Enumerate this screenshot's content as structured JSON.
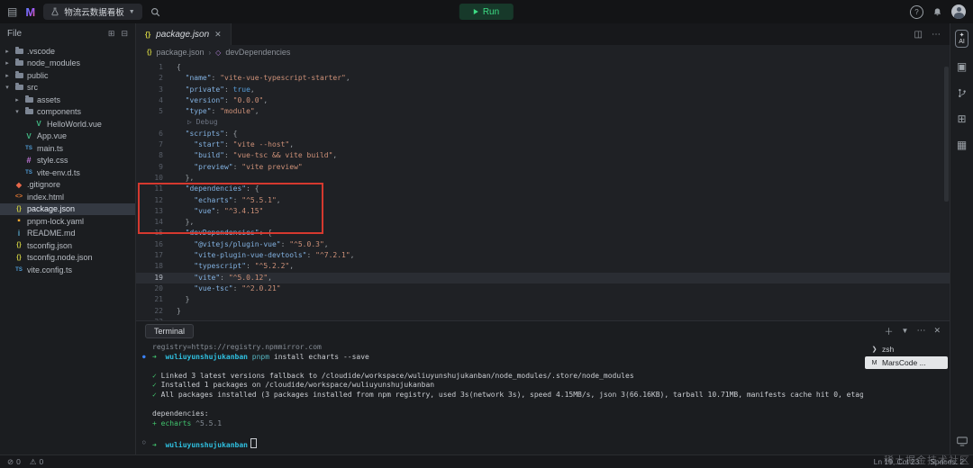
{
  "topbar": {
    "title": "物流云数据看板",
    "run_label": "Run"
  },
  "explorer": {
    "header": "File",
    "items": [
      {
        "label": ".vscode",
        "icon": "folder",
        "folder": true,
        "expanded": false,
        "level": 0
      },
      {
        "label": "node_modules",
        "icon": "folder",
        "folder": true,
        "expanded": false,
        "level": 0
      },
      {
        "label": "public",
        "icon": "folder",
        "folder": true,
        "expanded": false,
        "level": 0
      },
      {
        "label": "src",
        "icon": "folder",
        "folder": true,
        "expanded": true,
        "level": 0
      },
      {
        "label": "assets",
        "icon": "folder",
        "folder": true,
        "expanded": false,
        "level": 1
      },
      {
        "label": "components",
        "icon": "folder",
        "folder": true,
        "expanded": true,
        "level": 1
      },
      {
        "label": "HelloWorld.vue",
        "icon": "vue",
        "level": 2
      },
      {
        "label": "App.vue",
        "icon": "vue",
        "level": 1
      },
      {
        "label": "main.ts",
        "icon": "ts",
        "level": 1
      },
      {
        "label": "style.css",
        "icon": "css",
        "level": 1
      },
      {
        "label": "vite-env.d.ts",
        "icon": "ts",
        "level": 1
      },
      {
        "label": ".gitignore",
        "icon": "git",
        "level": 0
      },
      {
        "label": "index.html",
        "icon": "html",
        "level": 0
      },
      {
        "label": "package.json",
        "icon": "json",
        "level": 0,
        "selected": true
      },
      {
        "label": "pnpm-lock.yaml",
        "icon": "yaml",
        "level": 0
      },
      {
        "label": "README.md",
        "icon": "md",
        "level": 0
      },
      {
        "label": "tsconfig.json",
        "icon": "json",
        "level": 0
      },
      {
        "label": "tsconfig.node.json",
        "icon": "json",
        "level": 0
      },
      {
        "label": "vite.config.ts",
        "icon": "ts",
        "level": 0
      }
    ]
  },
  "editor": {
    "tab_label": "package.json",
    "breadcrumb": {
      "file": "package.json",
      "symbol": "devDependencies"
    },
    "active_line": 19,
    "lines": [
      {
        "n": 1,
        "seg": [
          [
            "p",
            "{"
          ]
        ]
      },
      {
        "n": 2,
        "seg": [
          [
            "p",
            "  "
          ],
          [
            "k",
            "\"name\""
          ],
          [
            "p",
            ": "
          ],
          [
            "v",
            "\"vite-vue-typescript-starter\""
          ],
          [
            "p",
            ","
          ]
        ]
      },
      {
        "n": 3,
        "seg": [
          [
            "p",
            "  "
          ],
          [
            "k",
            "\"private\""
          ],
          [
            "p",
            ": "
          ],
          [
            "b",
            "true"
          ],
          [
            "p",
            ","
          ]
        ]
      },
      {
        "n": 4,
        "seg": [
          [
            "p",
            "  "
          ],
          [
            "k",
            "\"version\""
          ],
          [
            "p",
            ": "
          ],
          [
            "v",
            "\"0.0.0\""
          ],
          [
            "p",
            ","
          ]
        ]
      },
      {
        "n": 5,
        "seg": [
          [
            "p",
            "  "
          ],
          [
            "k",
            "\"type\""
          ],
          [
            "p",
            ": "
          ],
          [
            "v",
            "\"module\""
          ],
          [
            "p",
            ","
          ]
        ]
      },
      {
        "lens": "Debug"
      },
      {
        "n": 6,
        "seg": [
          [
            "p",
            "  "
          ],
          [
            "k",
            "\"scripts\""
          ],
          [
            "p",
            ": {"
          ]
        ]
      },
      {
        "n": 7,
        "seg": [
          [
            "p",
            "    "
          ],
          [
            "k",
            "\"start\""
          ],
          [
            "p",
            ": "
          ],
          [
            "v",
            "\"vite --host\""
          ],
          [
            "p",
            ","
          ]
        ]
      },
      {
        "n": 8,
        "seg": [
          [
            "p",
            "    "
          ],
          [
            "k",
            "\"build\""
          ],
          [
            "p",
            ": "
          ],
          [
            "v",
            "\"vue-tsc && vite build\""
          ],
          [
            "p",
            ","
          ]
        ]
      },
      {
        "n": 9,
        "seg": [
          [
            "p",
            "    "
          ],
          [
            "k",
            "\"preview\""
          ],
          [
            "p",
            ": "
          ],
          [
            "v",
            "\"vite preview\""
          ]
        ]
      },
      {
        "n": 10,
        "seg": [
          [
            "p",
            "  },"
          ]
        ]
      },
      {
        "n": 11,
        "seg": [
          [
            "p",
            "  "
          ],
          [
            "k",
            "\"dependencies\""
          ],
          [
            "p",
            ": {"
          ]
        ]
      },
      {
        "n": 12,
        "seg": [
          [
            "p",
            "    "
          ],
          [
            "k",
            "\"echarts\""
          ],
          [
            "p",
            ": "
          ],
          [
            "v",
            "\"^5.5.1\""
          ],
          [
            "p",
            ","
          ]
        ]
      },
      {
        "n": 13,
        "seg": [
          [
            "p",
            "    "
          ],
          [
            "k",
            "\"vue\""
          ],
          [
            "p",
            ": "
          ],
          [
            "v",
            "\"^3.4.15\""
          ]
        ]
      },
      {
        "n": 14,
        "seg": [
          [
            "p",
            "  },"
          ]
        ]
      },
      {
        "n": 15,
        "seg": [
          [
            "p",
            "  "
          ],
          [
            "k",
            "\"devDependencies\""
          ],
          [
            "p",
            ": {"
          ]
        ]
      },
      {
        "n": 16,
        "seg": [
          [
            "p",
            "    "
          ],
          [
            "k",
            "\"@vitejs/plugin-vue\""
          ],
          [
            "p",
            ": "
          ],
          [
            "v",
            "\"^5.0.3\""
          ],
          [
            "p",
            ","
          ]
        ]
      },
      {
        "n": 17,
        "seg": [
          [
            "p",
            "    "
          ],
          [
            "k",
            "\"vite-plugin-vue-devtools\""
          ],
          [
            "p",
            ": "
          ],
          [
            "v",
            "\"^7.2.1\""
          ],
          [
            "p",
            ","
          ]
        ]
      },
      {
        "n": 18,
        "seg": [
          [
            "p",
            "    "
          ],
          [
            "k",
            "\"typescript\""
          ],
          [
            "p",
            ": "
          ],
          [
            "v",
            "\"^5.2.2\""
          ],
          [
            "p",
            ","
          ]
        ]
      },
      {
        "n": 19,
        "seg": [
          [
            "p",
            "    "
          ],
          [
            "k",
            "\"vite\""
          ],
          [
            "p",
            ": "
          ],
          [
            "v",
            "\"^5.0.12\""
          ],
          [
            "p",
            ","
          ]
        ]
      },
      {
        "n": 20,
        "seg": [
          [
            "p",
            "    "
          ],
          [
            "k",
            "\"vue-tsc\""
          ],
          [
            "p",
            ": "
          ],
          [
            "v",
            "\"^2.0.21\""
          ]
        ]
      },
      {
        "n": 21,
        "seg": [
          [
            "p",
            "  }"
          ]
        ]
      },
      {
        "n": 22,
        "seg": [
          [
            "p",
            "}"
          ]
        ]
      },
      {
        "n": 23,
        "seg": []
      }
    ]
  },
  "terminal": {
    "tab_label": "Terminal",
    "lines": [
      {
        "seg": [
          [
            "dim",
            "registry=https://registry.npmmirror.com"
          ]
        ]
      },
      {
        "marker": "dot",
        "seg": [
          [
            "g",
            "➜  "
          ],
          [
            "c",
            "wuliuyunshujukanban"
          ],
          [
            "w",
            " "
          ],
          [
            "t",
            "pnpm"
          ],
          [
            "w",
            " install echarts --save"
          ]
        ]
      },
      {
        "seg": []
      },
      {
        "seg": [
          [
            "g",
            "✓"
          ],
          [
            "w",
            " Linked 3 latest versions fallback to /cloudide/workspace/wuliuyunshujukanban/node_modules/.store/node_modules"
          ]
        ]
      },
      {
        "seg": [
          [
            "g",
            "✓"
          ],
          [
            "w",
            " Installed 1 packages on /cloudide/workspace/wuliuyunshujukanban"
          ]
        ]
      },
      {
        "seg": [
          [
            "g",
            "✓"
          ],
          [
            "w",
            " All packages installed (3 packages installed from npm registry, used 3s(network 3s), speed 4.15MB/s, json 3(66.16KB), tarball 10.71MB, manifests cache hit 0, etag hit 0 / miss 0)"
          ]
        ]
      },
      {
        "seg": []
      },
      {
        "seg": [
          [
            "w",
            "dependencies:"
          ]
        ]
      },
      {
        "seg": [
          [
            "g",
            "+ echarts "
          ],
          [
            "dim",
            "^5.5.1"
          ]
        ]
      },
      {
        "seg": []
      },
      {
        "marker": "circle",
        "seg": [
          [
            "g",
            "➜  "
          ],
          [
            "c",
            "wuliuyunshujukanban"
          ],
          [
            "cursor",
            ""
          ]
        ]
      }
    ],
    "side_items": [
      {
        "label": "zsh",
        "icon": "terminal",
        "selected": false
      },
      {
        "label": "MarsCode ...",
        "icon": "marscode",
        "selected": true
      }
    ]
  },
  "statusbar": {
    "errors": "0",
    "warnings": "0",
    "cursor": "Ln 19, Col 23",
    "spaces": "Spaces: 2"
  },
  "watermark": "稀土掘金技术社区"
}
